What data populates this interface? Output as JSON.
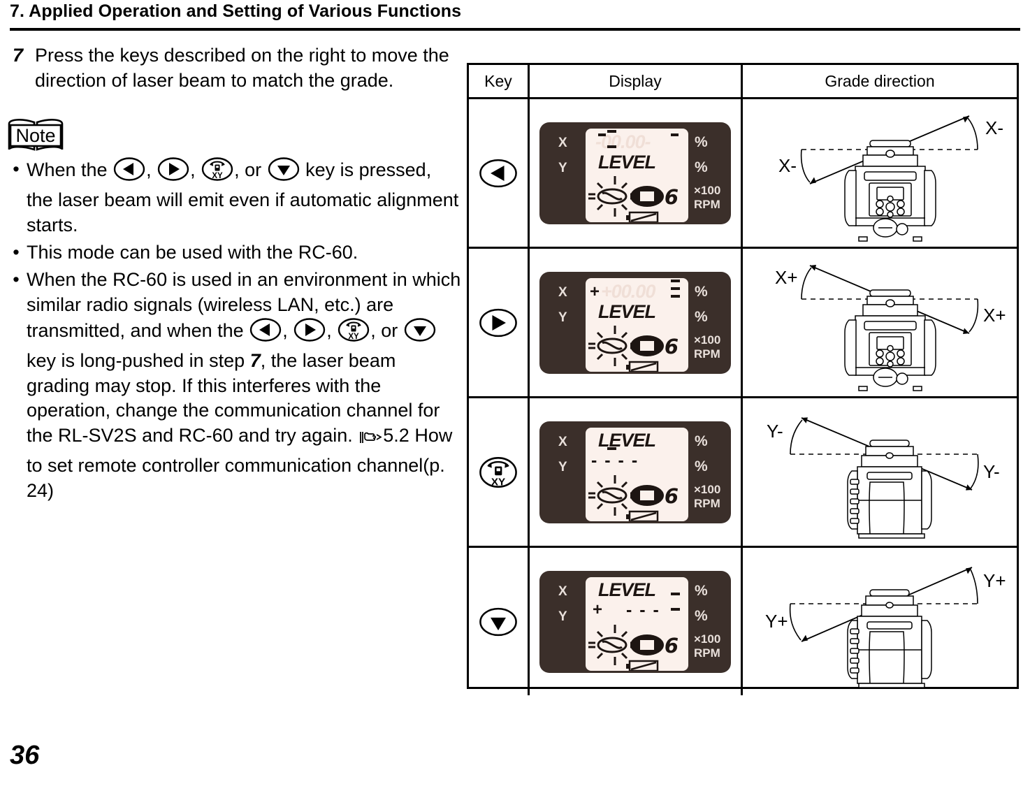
{
  "header": {
    "title": "7.  Applied Operation and Setting of Various Functions"
  },
  "step": {
    "number": "7",
    "text": "Press the keys described on the right to move the direction of laser beam to match the grade."
  },
  "note": {
    "label": "Note",
    "bullet_marker": "•",
    "items": [
      {
        "id": "note-1",
        "parts": [
          {
            "type": "text",
            "value": "When the "
          },
          {
            "type": "icon",
            "value": "left-arrow-key-icon"
          },
          {
            "type": "text",
            "value": ", "
          },
          {
            "type": "icon",
            "value": "right-arrow-key-icon"
          },
          {
            "type": "text",
            "value": ", "
          },
          {
            "type": "icon",
            "value": "xy-key-icon"
          },
          {
            "type": "text",
            "value": ", or "
          },
          {
            "type": "icon",
            "value": "down-arrow-key-icon"
          },
          {
            "type": "text",
            "value": " key is pressed, the laser beam will emit even if automatic alignment starts."
          }
        ]
      },
      {
        "id": "note-2",
        "parts": [
          {
            "type": "text",
            "value": "This mode can be used with the RC-60."
          }
        ]
      },
      {
        "id": "note-3",
        "parts": [
          {
            "type": "text",
            "value": "When the RC-60 is used in an environment in which similar radio signals (wireless LAN, etc.) are transmitted, and when the "
          },
          {
            "type": "icon",
            "value": "left-arrow-key-icon"
          },
          {
            "type": "text",
            "value": ", "
          },
          {
            "type": "icon",
            "value": "right-arrow-key-icon"
          },
          {
            "type": "text",
            "value": ", "
          },
          {
            "type": "icon",
            "value": "xy-key-icon"
          },
          {
            "type": "text",
            "value": ", or "
          },
          {
            "type": "icon",
            "value": "down-arrow-key-icon"
          },
          {
            "type": "text",
            "value": " key is long-pushed in step "
          },
          {
            "type": "bold",
            "value": "7"
          },
          {
            "type": "text",
            "value": ", the laser beam grading may stop. If this interferes with the operation, change the communication channel for the RL-SV2S and RC-60 and try again. "
          },
          {
            "type": "icon",
            "value": "pointing-hand-icon"
          },
          {
            "type": "text",
            "value": "5.2 How to set remote controller communication channel(p. 24)"
          }
        ]
      }
    ]
  },
  "table": {
    "headers": [
      "Key",
      "Display",
      "Grade direction"
    ],
    "rows": [
      {
        "key_icon": "left-arrow-key-icon",
        "display": {
          "x_label": "X",
          "y_label": "Y",
          "pct1": "%",
          "pct2": "%",
          "x100": "×100",
          "rpm": "RPM",
          "line1_value": "-00.00-",
          "line1_style": "ghost-with-dashes",
          "line2_value": "LEVEL",
          "rotation_value": "6",
          "sign": "",
          "arrow_side": "left"
        },
        "grade": {
          "view": "front",
          "label_left": "X-",
          "label_right": "X-",
          "tilt": "up-right"
        }
      },
      {
        "key_icon": "right-arrow-key-icon",
        "display": {
          "x_label": "X",
          "y_label": "Y",
          "pct1": "%",
          "pct2": "%",
          "x100": "×100",
          "rpm": "RPM",
          "line1_value": "+00.00",
          "line1_style": "ghost-with-dashes",
          "line2_value": "LEVEL",
          "rotation_value": "6",
          "sign": "+",
          "arrow_side": "right"
        },
        "grade": {
          "view": "front",
          "label_left": "X+",
          "label_right": "X+",
          "tilt": "up-left"
        }
      },
      {
        "key_icon": "xy-key-icon",
        "display": {
          "x_label": "X",
          "y_label": "Y",
          "pct1": "%",
          "pct2": "%",
          "x100": "×100",
          "rpm": "RPM",
          "line1_value": "LEVEL",
          "line1_style": "word",
          "line2_value": "- - - -",
          "rotation_value": "6",
          "sign": "",
          "arrow_side": "left"
        },
        "grade": {
          "view": "side",
          "label_left": "Y-",
          "label_right": "Y-",
          "tilt": "up-left"
        }
      },
      {
        "key_icon": "down-arrow-key-icon",
        "display": {
          "x_label": "X",
          "y_label": "Y",
          "pct1": "%",
          "pct2": "%",
          "x100": "×100",
          "rpm": "RPM",
          "line1_value": "LEVEL",
          "line1_style": "word",
          "line2_value": "- - -",
          "rotation_value": "6",
          "sign": "+",
          "arrow_side": "right"
        },
        "grade": {
          "view": "side",
          "label_left": "Y+",
          "label_right": "Y+",
          "tilt": "up-right"
        }
      }
    ]
  },
  "footer": {
    "page_number": "36"
  }
}
